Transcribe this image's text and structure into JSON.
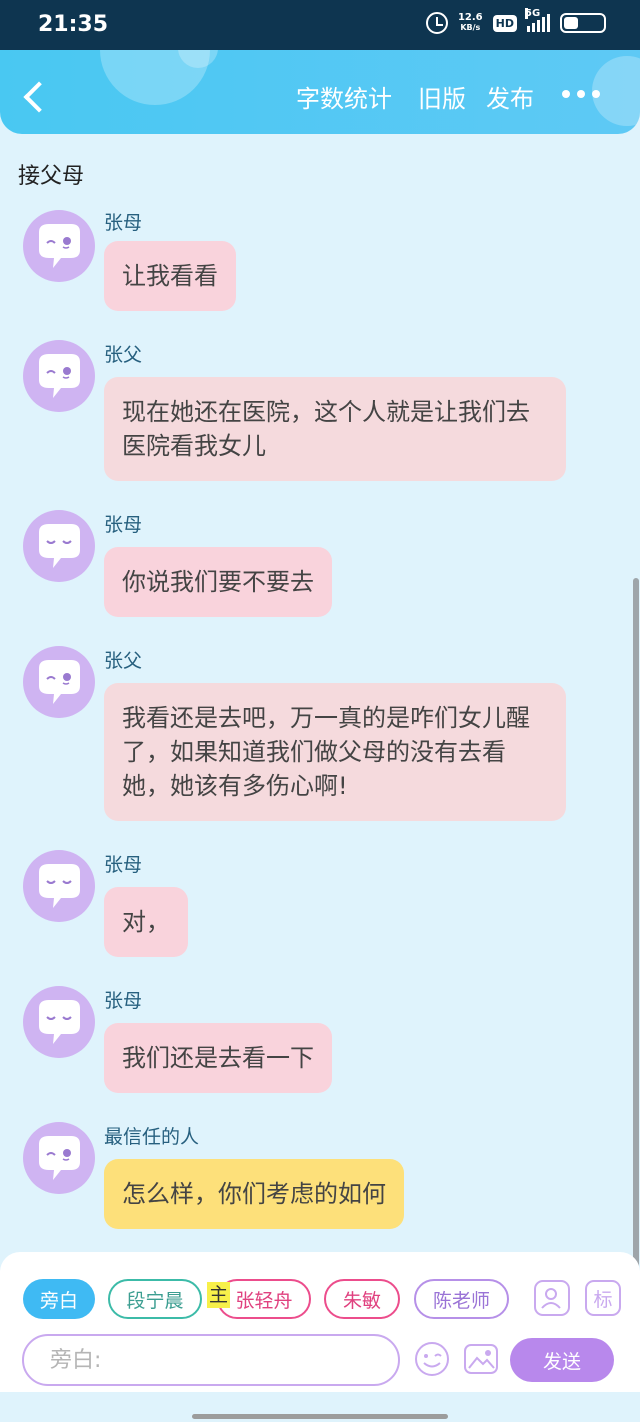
{
  "status_bar": {
    "time": "21:35",
    "speed_value": "12.6",
    "speed_unit": "KB/s",
    "hd": "HD",
    "network": "5G"
  },
  "header": {
    "word_count": "字数统计",
    "old_version": "旧版",
    "publish": "发布"
  },
  "chat_title": "接父母",
  "messages": [
    {
      "speaker": "张母",
      "text": "让我看看"
    },
    {
      "speaker": "张父",
      "text": "现在她还在医院，这个人就是让我们去医院看我女儿"
    },
    {
      "speaker": "张母",
      "text": "你说我们要不要去"
    },
    {
      "speaker": "张父",
      "text": "我看还是去吧，万一真的是咋们女儿醒了，如果知道我们做父母的没有去看她，她该有多伤心啊!"
    },
    {
      "speaker": "张母",
      "text": "对，"
    },
    {
      "speaker": "张母",
      "text": "我们还是去看一下"
    },
    {
      "speaker": "最信任的人",
      "text": "怎么样，你们考虑的如何"
    }
  ],
  "roles": [
    "旁白",
    "段宁晨",
    "张轻舟",
    "朱敏",
    "陈老师"
  ],
  "main_badge": "主",
  "tag_icon": "标",
  "input": {
    "placeholder": "旁白:"
  },
  "send": "发送",
  "colors": {
    "header": "#49c8f2",
    "background": "#dff3fc",
    "bubble_pink": "#f9d3dc",
    "bubble_rose": "#f5dadd",
    "bubble_yellow": "#fde07a",
    "avatar": "#cfb4f2",
    "send_button": "#b888ec"
  }
}
